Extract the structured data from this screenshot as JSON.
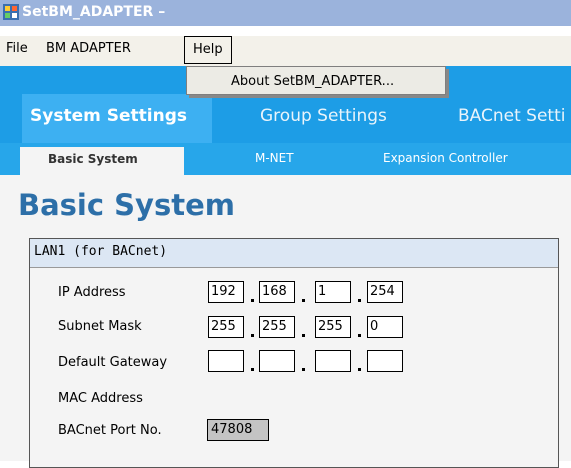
{
  "window": {
    "title": "SetBM_ADAPTER –"
  },
  "menubar": {
    "file": "File",
    "bm_adapter": "BM ADAPTER",
    "help": "Help"
  },
  "help_menu": {
    "about": "About SetBM_ADAPTER..."
  },
  "main_tabs": [
    "System Settings",
    "Group Settings",
    "BACnet Setti"
  ],
  "sub_tabs": [
    "Basic System",
    "M-NET",
    "Expansion Controller"
  ],
  "page": {
    "title": "Basic System"
  },
  "lan1": {
    "header": "LAN1 (for BACnet)",
    "labels": {
      "ip": "IP Address",
      "subnet": "Subnet Mask",
      "gateway": "Default Gateway",
      "mac": "MAC Address",
      "port": "BACnet Port No."
    },
    "ip": [
      "192",
      "168",
      "1",
      "254"
    ],
    "subnet": [
      "255",
      "255",
      "255",
      "0"
    ],
    "gateway": [
      "",
      "",
      "",
      ""
    ],
    "port": "47808"
  }
}
